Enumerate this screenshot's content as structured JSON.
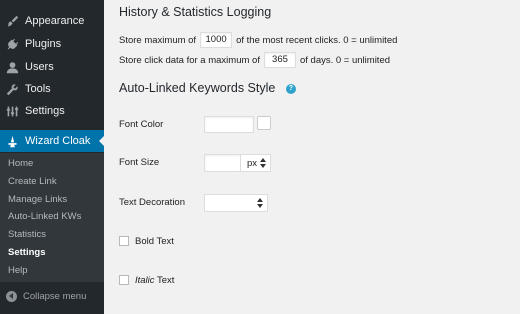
{
  "sidebar": {
    "items": [
      {
        "label": "Appearance",
        "icon": "paintbrush-icon"
      },
      {
        "label": "Plugins",
        "icon": "plugin-icon"
      },
      {
        "label": "Users",
        "icon": "user-icon"
      },
      {
        "label": "Tools",
        "icon": "wrench-icon"
      },
      {
        "label": "Settings",
        "icon": "settings-icon"
      },
      {
        "label": "Wizard Cloak",
        "icon": "wizard-icon"
      }
    ],
    "submenu": [
      "Home",
      "Create Link",
      "Manage Links",
      "Auto-Linked KWs",
      "Statistics",
      "Settings",
      "Help"
    ],
    "collapse_label": "Collapse menu"
  },
  "main": {
    "history_heading": "History & Statistics Logging",
    "store_max_prefix": "Store maximum of",
    "store_max_value": "1000",
    "store_max_suffix": "of the most recent clicks. 0 = unlimited",
    "store_days_prefix": "Store click data for a maximum of",
    "store_days_value": "365",
    "store_days_suffix": "of days. 0 = unlimited",
    "keywords_heading": "Auto-Linked Keywords Style",
    "help_icon_glyph": "?",
    "font_color_label": "Font Color",
    "font_size_label": "Font Size",
    "font_size_unit": "px",
    "text_decoration_label": "Text Decoration",
    "bold_label": "Bold Text",
    "italic_word": "Italic",
    "italic_rest": " Text"
  },
  "colors": {
    "sidebar_bg": "#23282d",
    "submenu_bg": "#32373c",
    "accent": "#0073aa",
    "page_bg": "#f1f1f1"
  }
}
